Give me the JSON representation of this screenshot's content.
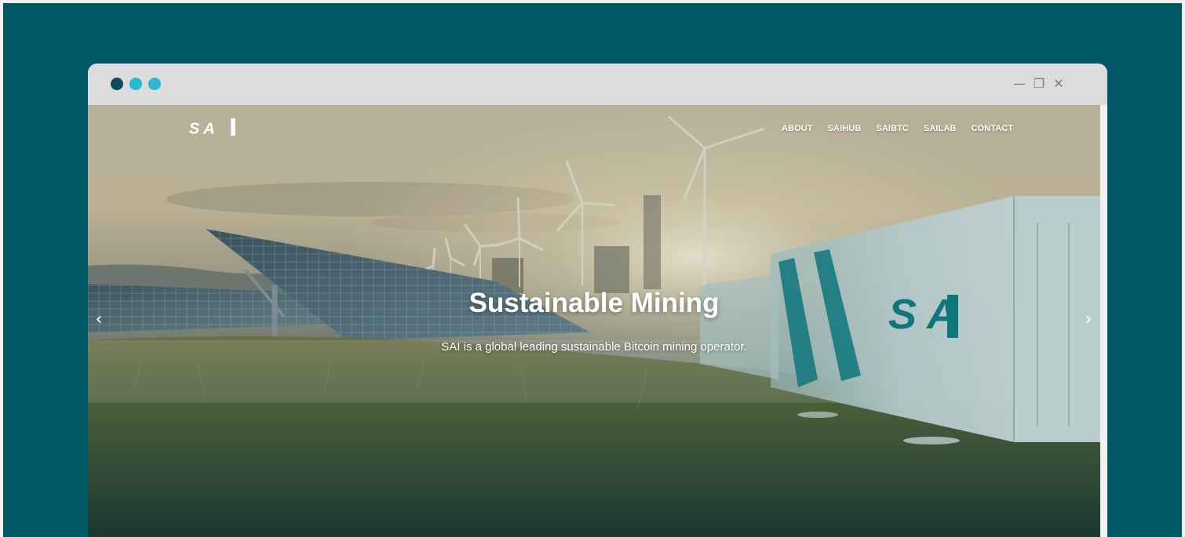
{
  "window": {
    "dots": [
      "#0b4a59",
      "#29b7d3",
      "#29b7d3"
    ],
    "controls": {
      "minimize": "—",
      "restore": "❐",
      "close": "✕"
    }
  },
  "site": {
    "logo_text": "SAI",
    "nav": [
      "ABOUT",
      "SAIHUB",
      "SAIBTC",
      "SAILAB",
      "CONTACT"
    ],
    "headline": "Sustainable Mining",
    "subline": "SAI is a global leading sustainable Bitcoin mining operator.",
    "prev_arrow": "‹",
    "next_arrow": "›",
    "container_brand": "SAI"
  },
  "colors": {
    "background": "#005866",
    "brand_teal": "#0f7f86"
  }
}
